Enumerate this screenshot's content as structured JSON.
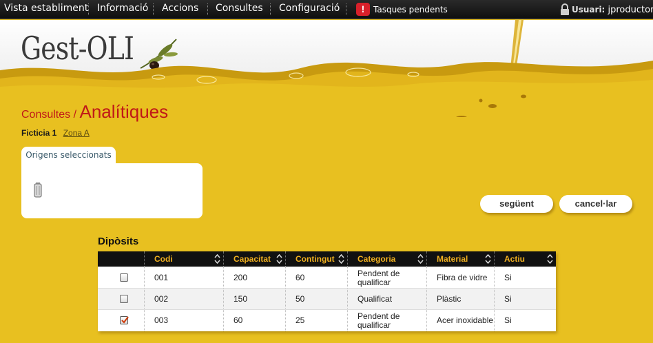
{
  "menu": {
    "items": [
      "Vista establiment",
      "Informació",
      "Accions",
      "Consultes",
      "Configuració"
    ],
    "tasks_label": "Tasques pendents",
    "user_prefix": "Usuari:",
    "user_name": "jproductor"
  },
  "header": {
    "logo": "Gest-OLI"
  },
  "breadcrumb": {
    "parent": "Consultes /",
    "title": "Analítiques"
  },
  "tabs": {
    "active": "Ficticia 1",
    "link": "Zona A"
  },
  "origins_panel": {
    "tab_label": "Origens seleccionats",
    "icon": "tank-icon"
  },
  "buttons": {
    "next": "següent",
    "cancel": "cancel·lar"
  },
  "table": {
    "title": "Dipòsits",
    "columns": [
      "Codi",
      "Capacitat",
      "Contingut",
      "Categoria",
      "Material",
      "Actiu"
    ],
    "rows": [
      {
        "checked": false,
        "codi": "001",
        "capacitat": "200",
        "contingut": "60",
        "categoria": "Pendent de qualificar",
        "material": "Fibra de vidre",
        "actiu": "Si"
      },
      {
        "checked": false,
        "codi": "002",
        "capacitat": "150",
        "contingut": "50",
        "categoria": "Qualificat",
        "material": "Plàstic",
        "actiu": "Si"
      },
      {
        "checked": true,
        "codi": "003",
        "capacitat": "60",
        "contingut": "25",
        "categoria": "Pendent de qualificar",
        "material": "Acer inoxidable",
        "actiu": "Si"
      }
    ]
  },
  "colors": {
    "accent": "#c01818",
    "background": "#e8c020",
    "header_text": "#f0b020"
  }
}
